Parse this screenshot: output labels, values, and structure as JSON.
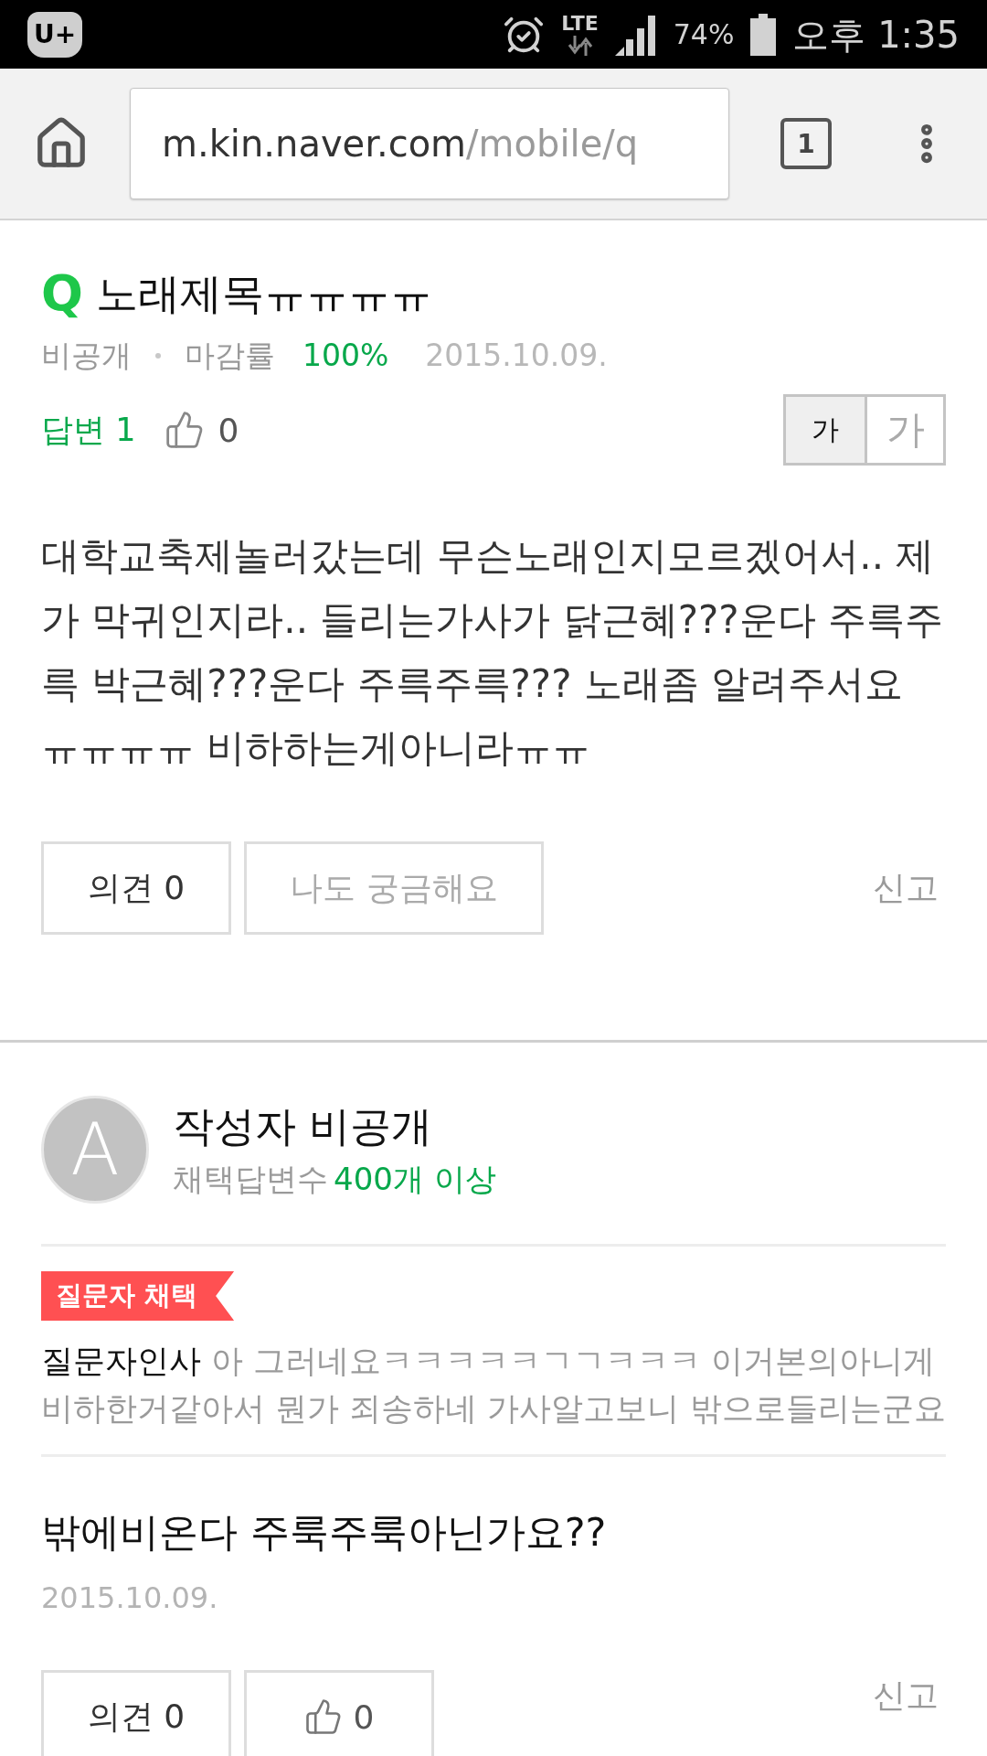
{
  "status_bar": {
    "carrier": "U+",
    "network": "LTE",
    "battery": "74%",
    "time": "오후 1:35"
  },
  "browser": {
    "url_host": "m.kin.naver.com",
    "url_path": "/mobile/q",
    "tab_count": "1"
  },
  "question": {
    "marker": "Q",
    "title": "노래제목ㅠㅠㅠㅠ",
    "visibility": "비공개",
    "close_rate_label": "마감률",
    "close_rate": "100%",
    "date": "2015.10.09.",
    "answers": "답변 1",
    "likes": "0",
    "font_size_options": [
      {
        "kind": "small",
        "label": "가",
        "selected": true
      },
      {
        "kind": "large",
        "label": "가",
        "selected": false
      }
    ],
    "body": "대학교축제놀러갔는데 무슨노래인지모르겠어서.. 제가 막귀인지라.. 들리는가사가 닭근혜???운다 주륵주륵 박근혜???운다 주륵주륵??? 노래좀 알려주서요 ㅠㅠㅠㅠ 비하하는게아니라ㅠㅠ",
    "actions": [
      {
        "kind": "comment",
        "label": "의견 0"
      },
      {
        "kind": "curious",
        "label": "나도 궁금해요"
      }
    ],
    "report": "신고"
  },
  "answer": {
    "avatar_letter": "A",
    "author": "작성자 비공개",
    "stat_label": "채택답변수",
    "stat_value": "400개 이상",
    "badge": "질문자 채택",
    "greeting": "**질문자인사** 아 그러네요ㅋㅋㅋㅋㅋㄱㄱㅋㅋㅋ 이거본의아니게 비하한거같아서 뭔가 죄송하네 가사알고보니 밖으로들리는군요",
    "body": "밖에비온다 주룩주룩아닌가요??",
    "date": "2015.10.09.",
    "actions": [
      {
        "kind": "comment",
        "label": "의견 0"
      },
      {
        "kind": "like",
        "label": "0"
      }
    ],
    "report": "신고"
  }
}
